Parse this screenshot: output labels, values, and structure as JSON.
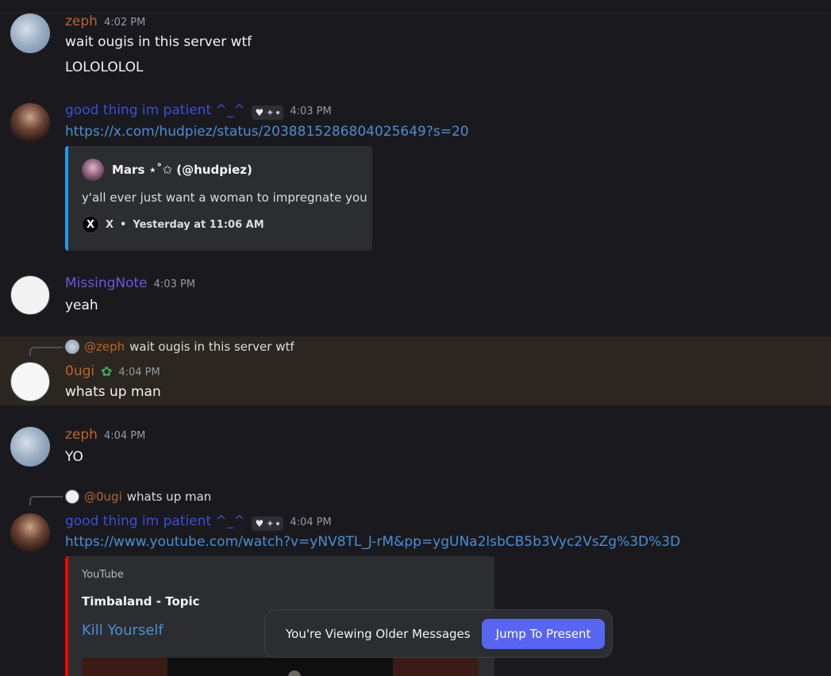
{
  "colors": {
    "zeph": "#c0632b",
    "good_thing": "#3a4fd6",
    "missingnote": "#6c56e0",
    "ougi": "#c0632b",
    "link": "#4b8ed6",
    "jump_button": "#5865f2",
    "twitter_bar": "#1d9bf0",
    "youtube_bar": "#ff0000"
  },
  "messages": [
    {
      "user": "zeph",
      "time": "4:02 PM",
      "lines": [
        "wait ougis in this server wtf",
        "LOLOLOLOL"
      ]
    },
    {
      "user": "good thing im patient ^_^",
      "time": "4:03 PM",
      "link": "https://x.com/hudpiez/status/2038815286804025649?s=20",
      "embed": {
        "author": "Mars ⋆˚✩ (@hudpiez)",
        "text": "y'all ever just want a woman to impregnate you",
        "source": "X",
        "sep": "•",
        "date": "Yesterday at 11:06 AM"
      }
    },
    {
      "user": "MissingNote",
      "time": "4:03 PM",
      "lines": [
        "yeah"
      ]
    },
    {
      "reply_to": "@zeph",
      "reply_text": "wait ougis in this server wtf",
      "user": "0ugi",
      "time": "4:04 PM",
      "lines": [
        "whats up man"
      ]
    },
    {
      "user": "zeph",
      "time": "4:04 PM",
      "lines": [
        "YO"
      ]
    },
    {
      "reply_to": "@0ugi",
      "reply_text": "whats up man",
      "user": "good thing im patient ^_^",
      "time": "4:04 PM",
      "link": "https://www.youtube.com/watch?v=yNV8TL_J-rM&pp=ygUNa2lsbCB5b3Vyc2VsZg%3D%3D",
      "embed": {
        "provider": "YouTube",
        "author": "Timbaland - Topic",
        "title": "Kill Yourself"
      }
    }
  ],
  "jump_bar": {
    "text": "You're Viewing Older Messages",
    "button": "Jump To Present"
  },
  "icons": {
    "badge_heart": "heart-icon",
    "badge_wing": "wing-icon",
    "ougi_badge": "clover-icon",
    "x_logo": "x-logo-icon"
  }
}
